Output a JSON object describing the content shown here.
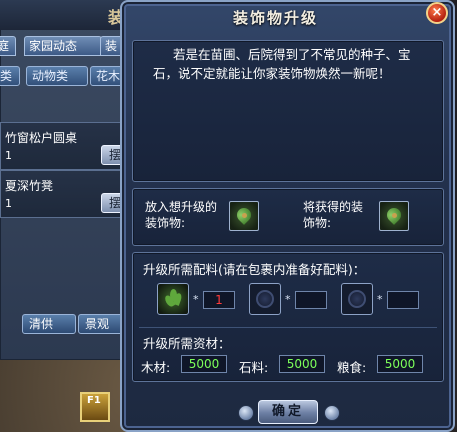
{
  "background": {
    "title_char": "装",
    "tabs": [
      "庭",
      "家园动态",
      "装"
    ],
    "subtabs": [
      "类",
      "动物类",
      "花木"
    ],
    "items": [
      {
        "name": "竹窗松户圆桌",
        "count": "1",
        "button": "摆"
      },
      {
        "name": "夏深竹凳",
        "count": "1",
        "button": "摆"
      }
    ],
    "bottom_tabs": [
      "清供",
      "景观"
    ],
    "skill_slot_label": "F1"
  },
  "dialog": {
    "title": "装饰物升级",
    "close_label": "×",
    "description": "若是在苗圃、后院得到了不常见的种子、宝石，说不定就能让你家装饰物焕然一新呢！",
    "slots": {
      "input_label": "放入想升级的装饰物:",
      "output_label": "将获得的装饰物:"
    },
    "materials": {
      "title": "升级所需配料(请在包裹内准备好配料)：",
      "items": [
        {
          "qty": "1",
          "filled": true
        },
        {
          "qty": "",
          "filled": false
        },
        {
          "qty": "",
          "filled": false
        }
      ],
      "multiply_sign": "*"
    },
    "resources": {
      "title": "升级所需资材：",
      "wood_label": "木材:",
      "wood_value": "5000",
      "stone_label": "石料:",
      "stone_value": "5000",
      "food_label": "粮食:",
      "food_value": "5000"
    },
    "confirm_label": "确定"
  }
}
